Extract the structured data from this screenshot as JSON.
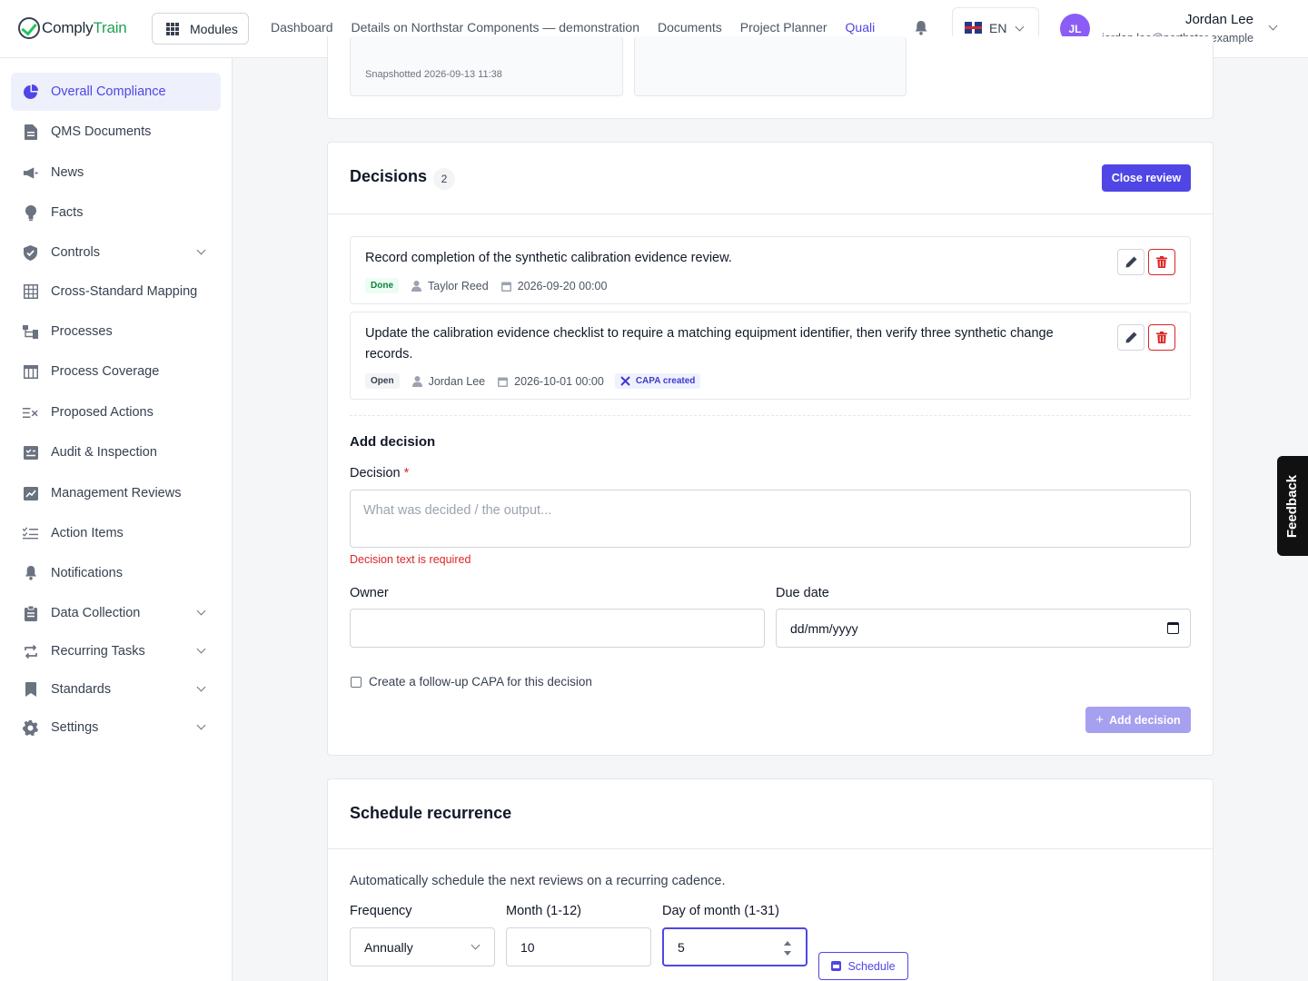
{
  "brand": {
    "name_part1": "Comply",
    "name_part2": "Train"
  },
  "header": {
    "modules_label": "Modules",
    "nav": [
      "Dashboard",
      "Details on Northstar Components — demonstration",
      "Documents",
      "Project Planner",
      "Quali"
    ],
    "language": "EN",
    "user": {
      "initials": "JL",
      "name": "Jordan Lee",
      "email": "jordan.lee@northstar.example"
    }
  },
  "sidebar": {
    "items": [
      {
        "label": "Overall Compliance",
        "icon": "pie-chart-icon",
        "active": true
      },
      {
        "label": "QMS Documents",
        "icon": "document-icon"
      },
      {
        "label": "News",
        "icon": "megaphone-icon"
      },
      {
        "label": "Facts",
        "icon": "lightbulb-icon"
      },
      {
        "label": "Controls",
        "icon": "shield-check-icon",
        "expandable": true
      },
      {
        "label": "Cross-Standard Mapping",
        "icon": "table-grid-icon"
      },
      {
        "label": "Processes",
        "icon": "flow-icon"
      },
      {
        "label": "Process Coverage",
        "icon": "table-icon"
      },
      {
        "label": "Proposed Actions",
        "icon": "list-x-icon"
      },
      {
        "label": "Audit & Inspection",
        "icon": "clipboard-check-icon"
      },
      {
        "label": "Management Reviews",
        "icon": "chart-review-icon"
      },
      {
        "label": "Action Items",
        "icon": "checklist-icon"
      },
      {
        "label": "Notifications",
        "icon": "bell-icon"
      },
      {
        "label": "Data Collection",
        "icon": "clipboard-icon",
        "expandable": true
      },
      {
        "label": "Recurring Tasks",
        "icon": "repeat-icon",
        "expandable": true
      },
      {
        "label": "Standards",
        "icon": "bookmark-icon",
        "expandable": true
      },
      {
        "label": "Settings",
        "icon": "gear-icon",
        "expandable": true
      }
    ]
  },
  "snapshot": {
    "text": "Snapshotted 2026-09-13 11:38"
  },
  "decisions": {
    "title": "Decisions",
    "count": "2",
    "close_button": "Close review",
    "items": [
      {
        "text": "Record completion of the synthetic calibration evidence review.",
        "status": "Done",
        "owner": "Taylor Reed",
        "due": "2026-09-20 00:00"
      },
      {
        "text": "Update the calibration evidence checklist to require a matching equipment identifier, then verify three synthetic change records.",
        "status": "Open",
        "owner": "Jordan Lee",
        "due": "2026-10-01 00:00",
        "badge": "CAPA created"
      }
    ],
    "form": {
      "title": "Add decision",
      "decision_label": "Decision",
      "required_mark": "*",
      "decision_placeholder": "What was decided / the output...",
      "error": "Decision text is required",
      "owner_label": "Owner",
      "owner_value": "",
      "due_label": "Due date",
      "due_placeholder": "dd/mm/yyyy",
      "capa_checkbox_label": "Create a follow-up CAPA for this decision",
      "capa_checked": false,
      "submit_label": "Add decision"
    }
  },
  "recurrence": {
    "title": "Schedule recurrence",
    "description": "Automatically schedule the next reviews on a recurring cadence.",
    "frequency_label": "Frequency",
    "frequency_value": "Annually",
    "month_label": "Month (1-12)",
    "month_value": "10",
    "day_label": "Day of month (1-31)",
    "day_value": "5",
    "schedule_button": "Schedule"
  },
  "feedback_tab": "Feedback",
  "colors": {
    "accent": "#4f46e5",
    "success": "#15803d",
    "danger": "#dc2626",
    "brand_green": "#22a155"
  }
}
